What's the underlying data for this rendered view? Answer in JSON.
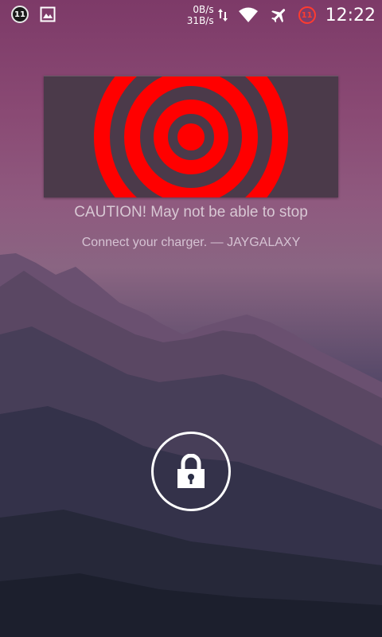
{
  "status_bar": {
    "left_icons": [
      {
        "name": "notification-badge-icon",
        "text": "11"
      },
      {
        "name": "image-notification-icon"
      }
    ],
    "net_speed_down": "0B/s",
    "net_speed_up": "31B/s",
    "alert_badge": "11",
    "time": "12:22",
    "icons": [
      "data-transfer-icon",
      "wifi-icon",
      "airplane-mode-icon"
    ]
  },
  "lockscreen": {
    "caution_message": "CAUTION! May not be able to stop",
    "owner_info": "Connect your charger. — JAYGALAXY",
    "lock_icon": "padlock-icon"
  },
  "colors": {
    "target_red": "#ff0000",
    "widget_bg": "#4b3a4a",
    "alert_red": "#ff3b2f"
  }
}
